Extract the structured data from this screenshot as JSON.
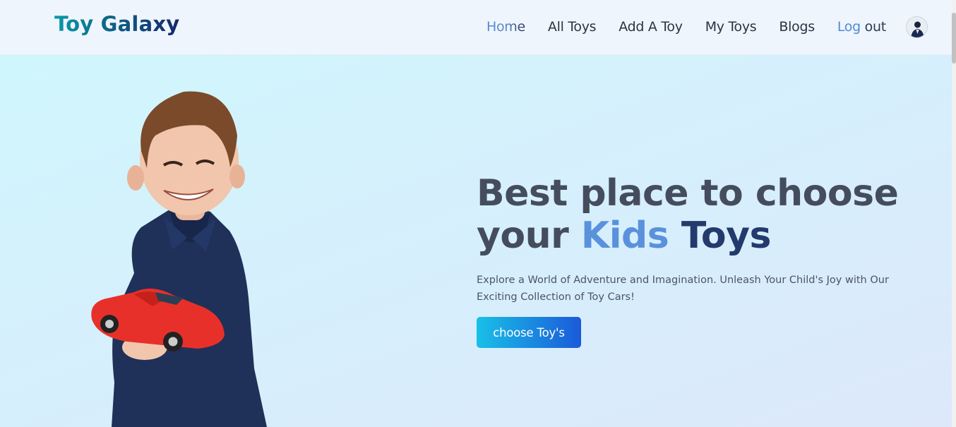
{
  "brand": {
    "name": "Toy Galaxy"
  },
  "nav": {
    "items": [
      {
        "label": "Home",
        "active": true
      },
      {
        "label": "All Toys",
        "active": false
      },
      {
        "label": "Add A Toy",
        "active": false
      },
      {
        "label": "My Toys",
        "active": false
      },
      {
        "label": "Blogs",
        "active": false
      }
    ],
    "logout_part1": "Log",
    "logout_part2": "out"
  },
  "hero": {
    "headline_line1": "Best place to choose",
    "headline_your": "your",
    "headline_kids": "Kids",
    "headline_toys": "Toys",
    "subtext": "Explore a World of Adventure and Imagination. Unleash Your Child's Joy with Our Exciting Collection of Toy Cars!",
    "cta_label": "choose Toy's"
  },
  "colors": {
    "accent_blue": "#5a91dc",
    "navy": "#233a6d",
    "cta_start": "#19c0e8",
    "cta_end": "#1a5ad9",
    "hero_bg": "#d0f6fd"
  }
}
